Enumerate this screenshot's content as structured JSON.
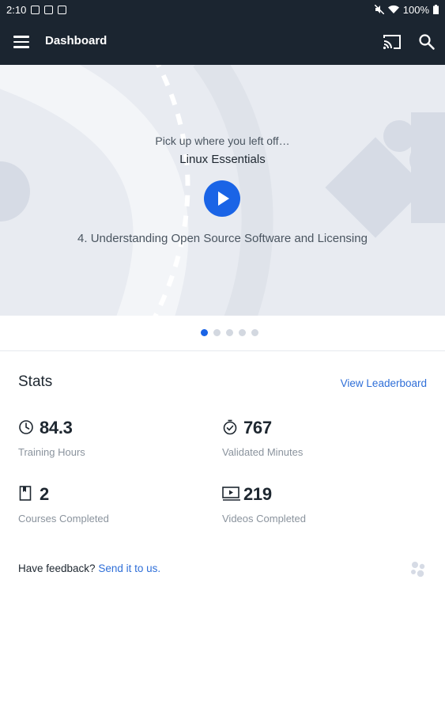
{
  "status_bar": {
    "time": "2:10",
    "battery": "100%"
  },
  "app_bar": {
    "title": "Dashboard"
  },
  "hero": {
    "subtitle": "Pick up where you left off…",
    "course_title": "Linux Essentials",
    "lesson_title": "4. Understanding Open Source Software and Licensing"
  },
  "pager": {
    "total": 5,
    "active_index": 0
  },
  "stats": {
    "title": "Stats",
    "leaderboard_link": "View Leaderboard",
    "items": [
      {
        "icon": "clock-icon",
        "value": "84.3",
        "label": "Training Hours"
      },
      {
        "icon": "stopwatch-check-icon",
        "value": "767",
        "label": "Validated Minutes"
      },
      {
        "icon": "book-icon",
        "value": "2",
        "label": "Courses Completed"
      },
      {
        "icon": "video-icon",
        "value": "219",
        "label": "Videos Completed"
      }
    ]
  },
  "feedback": {
    "prompt": "Have feedback?",
    "link": "Send it to us."
  },
  "colors": {
    "app_bar": "#1b2530",
    "accent": "#1a64e6",
    "link": "#2f6fd8",
    "hero_bg": "#e8ebf1"
  }
}
